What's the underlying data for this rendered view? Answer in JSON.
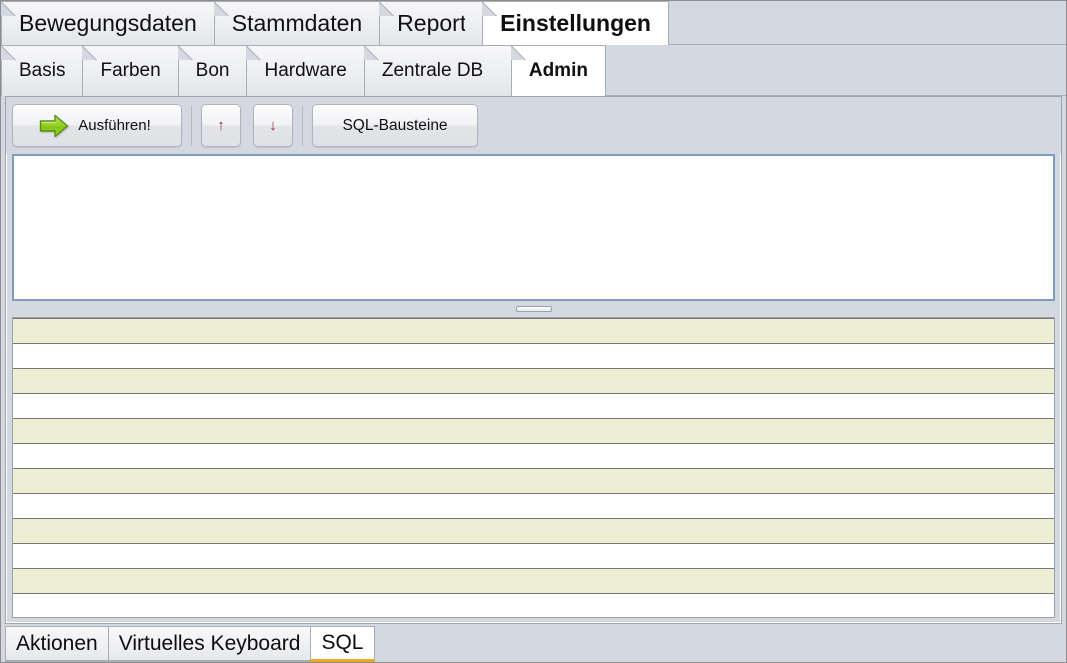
{
  "window": {
    "background_color": "#d4d8e0",
    "border_color": "#8d8d8d"
  },
  "main_tabs": {
    "items": [
      {
        "label": "Bewegungsdaten",
        "active": false
      },
      {
        "label": "Stammdaten",
        "active": false
      },
      {
        "label": "Reporte",
        "active": false,
        "clipped": true
      },
      {
        "label": "Einstellungen",
        "active": true
      }
    ]
  },
  "sub_tabs": {
    "items": [
      {
        "label": "Basis",
        "active": false
      },
      {
        "label": "Farben",
        "active": false
      },
      {
        "label": "Bon",
        "active": false
      },
      {
        "label": "Hardware",
        "active": false
      },
      {
        "label": "Zentrale DB",
        "active": false,
        "clipped": true
      },
      {
        "label": "Admin",
        "active": true
      }
    ]
  },
  "toolbar": {
    "execute_label": "Ausführen!",
    "execute_icon": "green-right-arrow-icon",
    "execute_icon_color": "#8fce26",
    "move_up_label": "↑",
    "move_up_icon": "arrow-up-icon",
    "move_down_label": "↓",
    "move_down_icon": "arrow-down-icon",
    "sql_snippets_label": "SQL-Bausteine"
  },
  "sql_editor": {
    "value": "",
    "placeholder": "",
    "focused": true,
    "border_color": "#7f9cc0"
  },
  "splitter": {
    "grip_icon": "splitter-grip-icon"
  },
  "results_grid": {
    "columns": [],
    "rows": [
      {
        "cells": []
      },
      {
        "cells": []
      },
      {
        "cells": []
      },
      {
        "cells": []
      },
      {
        "cells": []
      },
      {
        "cells": []
      },
      {
        "cells": []
      },
      {
        "cells": []
      },
      {
        "cells": []
      },
      {
        "cells": []
      },
      {
        "cells": []
      },
      {
        "cells": []
      }
    ],
    "alt_row_color": "#eeeed5",
    "row_color": "#ffffff"
  },
  "bottom_tabs": {
    "items": [
      {
        "label": "Aktionen",
        "active": false
      },
      {
        "label": "Virtuelles Keyboard",
        "active": false
      },
      {
        "label": "SQL",
        "active": true
      }
    ],
    "active_underline_color": "#f0a81e"
  }
}
